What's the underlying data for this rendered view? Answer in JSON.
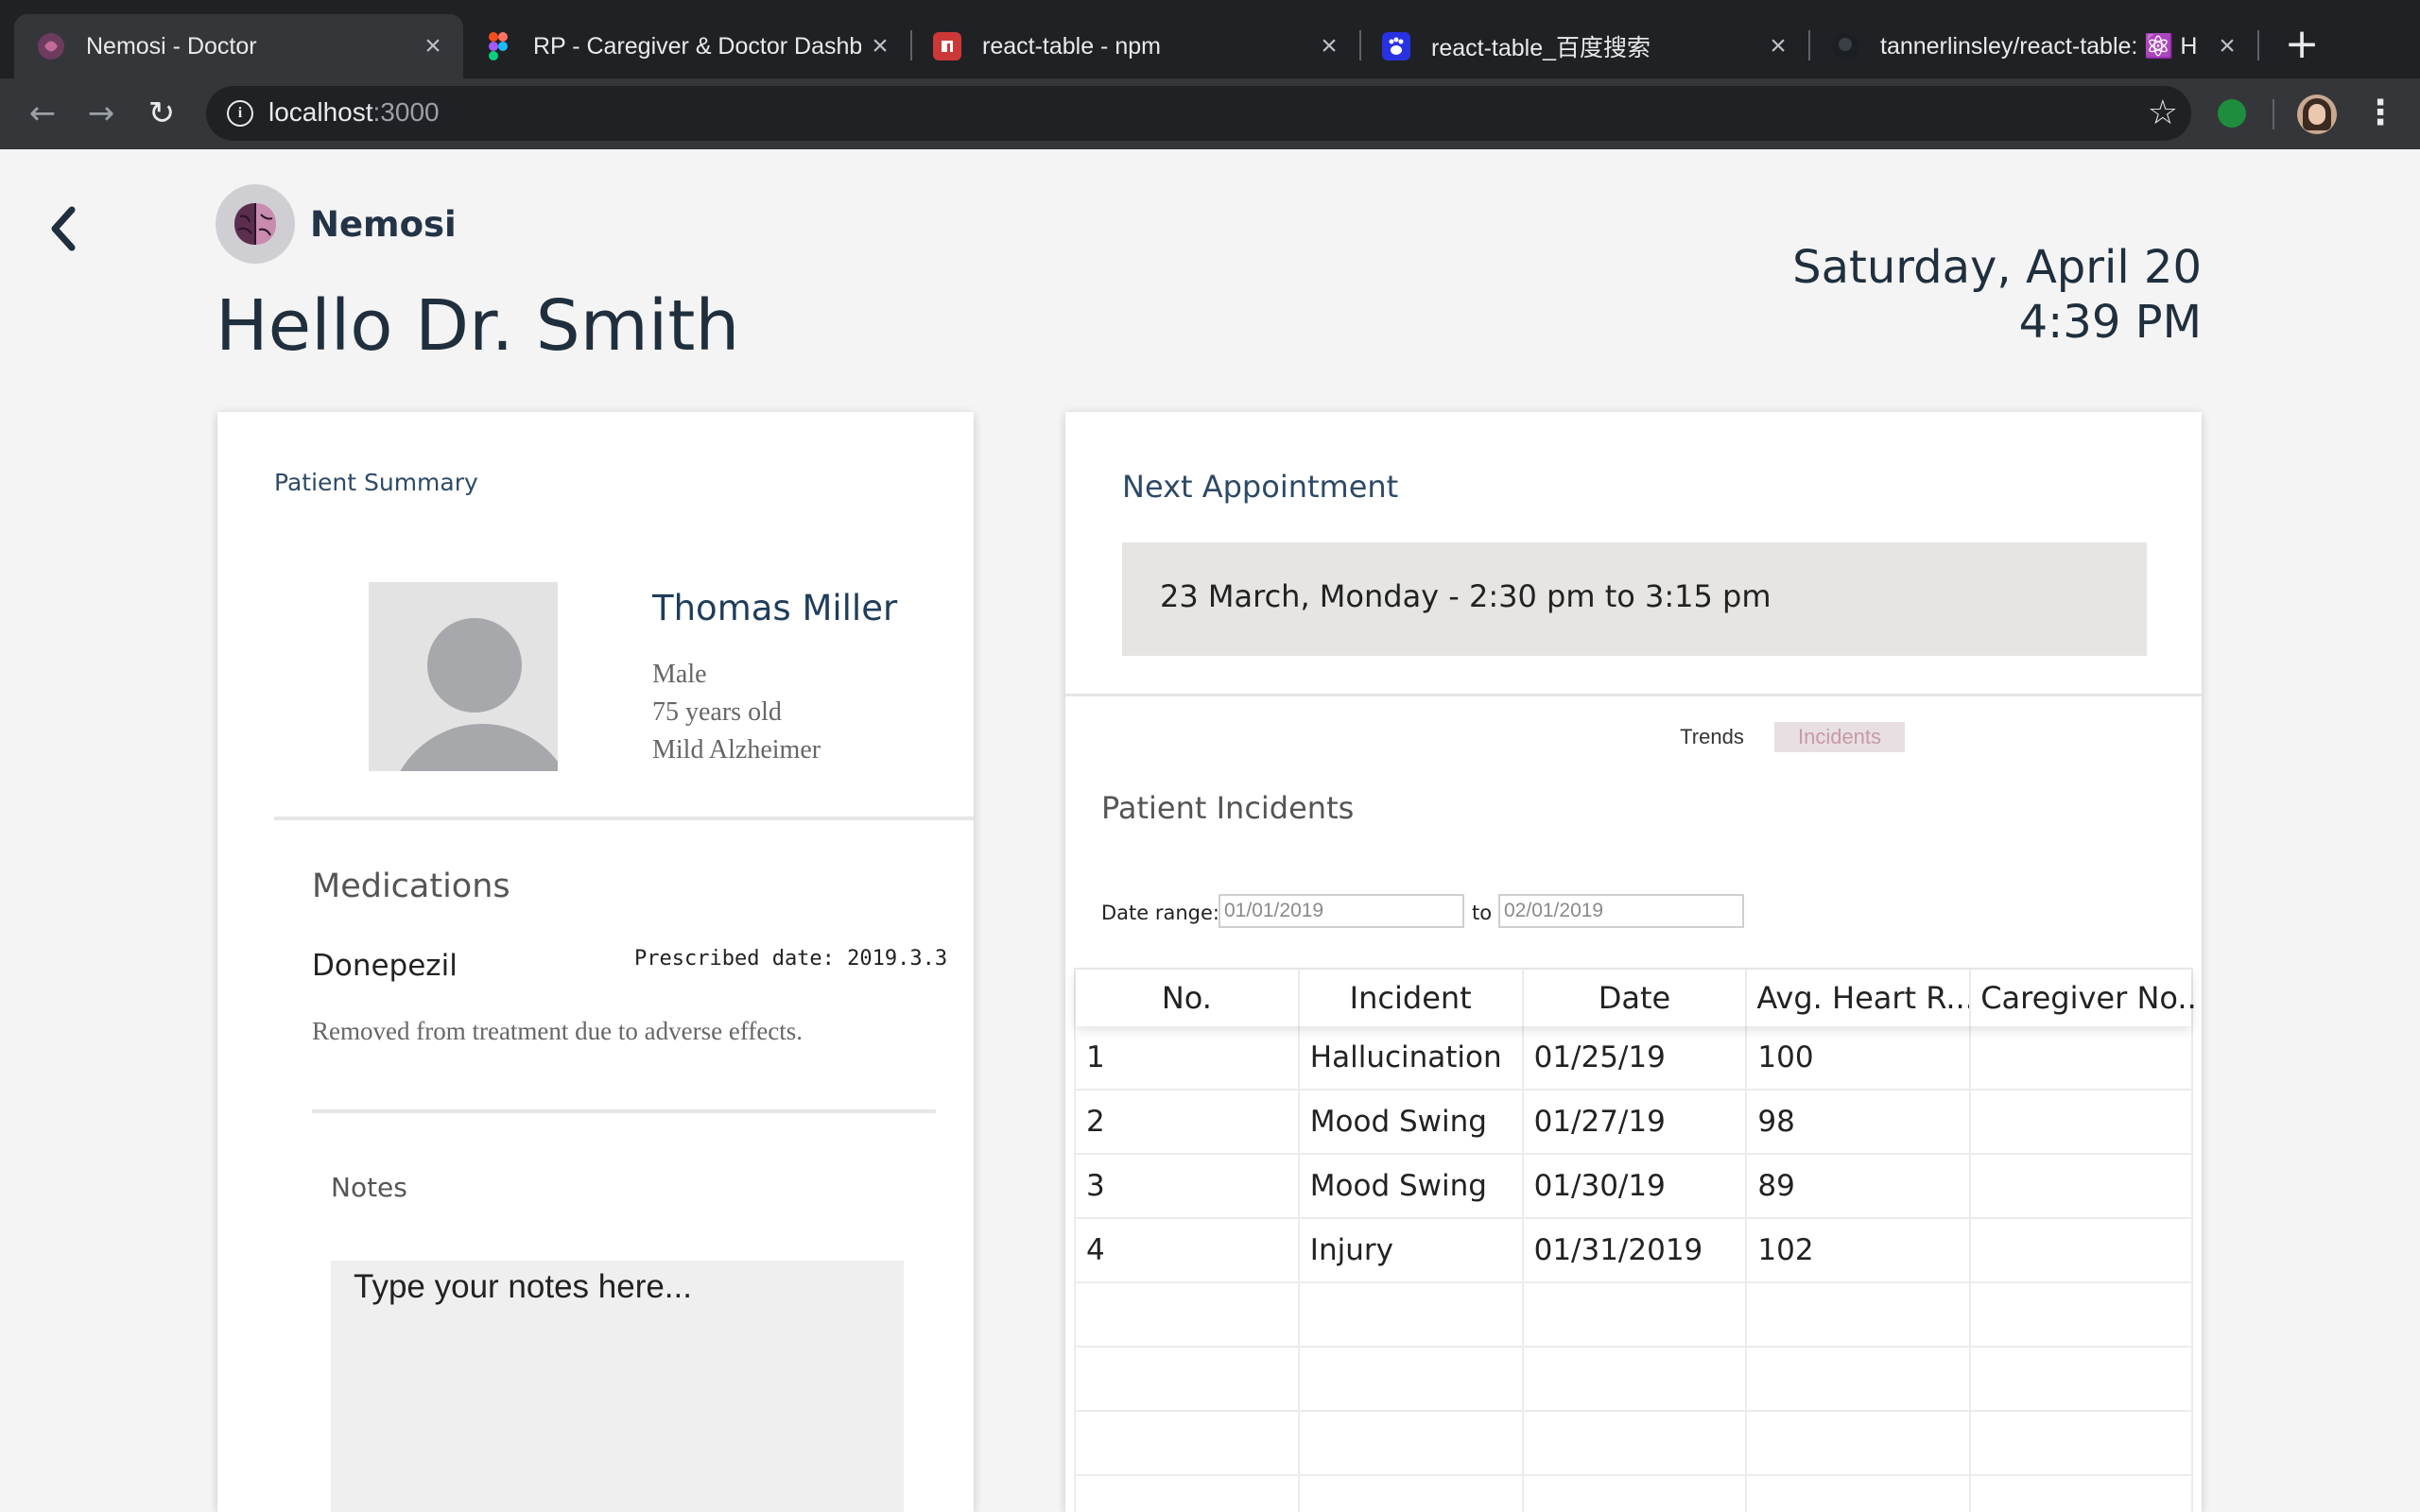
{
  "browser": {
    "tabs": [
      {
        "title": "Nemosi - Doctor",
        "icon": "nemosi-favicon",
        "active": true
      },
      {
        "title": "RP - Caregiver & Doctor Dashb",
        "icon": "figma-favicon",
        "active": false
      },
      {
        "title": "react-table - npm",
        "icon": "npm-favicon",
        "active": false
      },
      {
        "title": "react-table_百度搜索",
        "icon": "baidu-favicon",
        "active": false
      },
      {
        "title": "tannerlinsley/react-table: ⚛️ H",
        "icon": "github-favicon",
        "active": false
      }
    ],
    "url_host": "localhost",
    "url_port": ":3000"
  },
  "header": {
    "brand": "Nemosi",
    "greeting": "Hello Dr. Smith",
    "date": "Saturday, April 20",
    "time": "4:39 PM"
  },
  "patient_summary": {
    "title": "Patient Summary",
    "name": "Thomas Miller",
    "gender": "Male",
    "age": "75 years old",
    "condition": "Mild Alzheimer"
  },
  "medications": {
    "title": "Medications",
    "name": "Donepezil",
    "prescribed": "Prescribed date: 2019.3.3",
    "note": "Removed from treatment due to adverse effects."
  },
  "notes": {
    "title": "Notes",
    "placeholder": "Type your notes here..."
  },
  "appointment": {
    "title": "Next Appointment",
    "text": "23 March, Monday - 2:30 pm to 3:15 pm"
  },
  "tabs": {
    "trends": "Trends",
    "incidents": "Incidents"
  },
  "incidents": {
    "title": "Patient Incidents",
    "date_range_label": "Date range:",
    "from": "01/01/2019",
    "to_label": "to",
    "to": "02/01/2019",
    "columns": [
      "No.",
      "Incident",
      "Date",
      "Avg. Heart R...",
      "Caregiver No..."
    ],
    "rows": [
      [
        "1",
        "Hallucination",
        "01/25/19",
        "100",
        ""
      ],
      [
        "2",
        "Mood Swing",
        "01/27/19",
        "98",
        ""
      ],
      [
        "3",
        "Mood Swing",
        "01/30/19",
        "89",
        ""
      ],
      [
        "4",
        "Injury",
        "01/31/2019",
        "102",
        ""
      ],
      [
        "",
        "",
        "",
        "",
        ""
      ],
      [
        "",
        "",
        "",
        "",
        ""
      ],
      [
        "",
        "",
        "",
        "",
        ""
      ],
      [
        "",
        "",
        "",
        "",
        ""
      ]
    ]
  },
  "colors": {
    "accent": "#2d4a66",
    "incidents_tab_bg": "#e8dfe2",
    "incidents_tab_text": "#c79aa6"
  }
}
